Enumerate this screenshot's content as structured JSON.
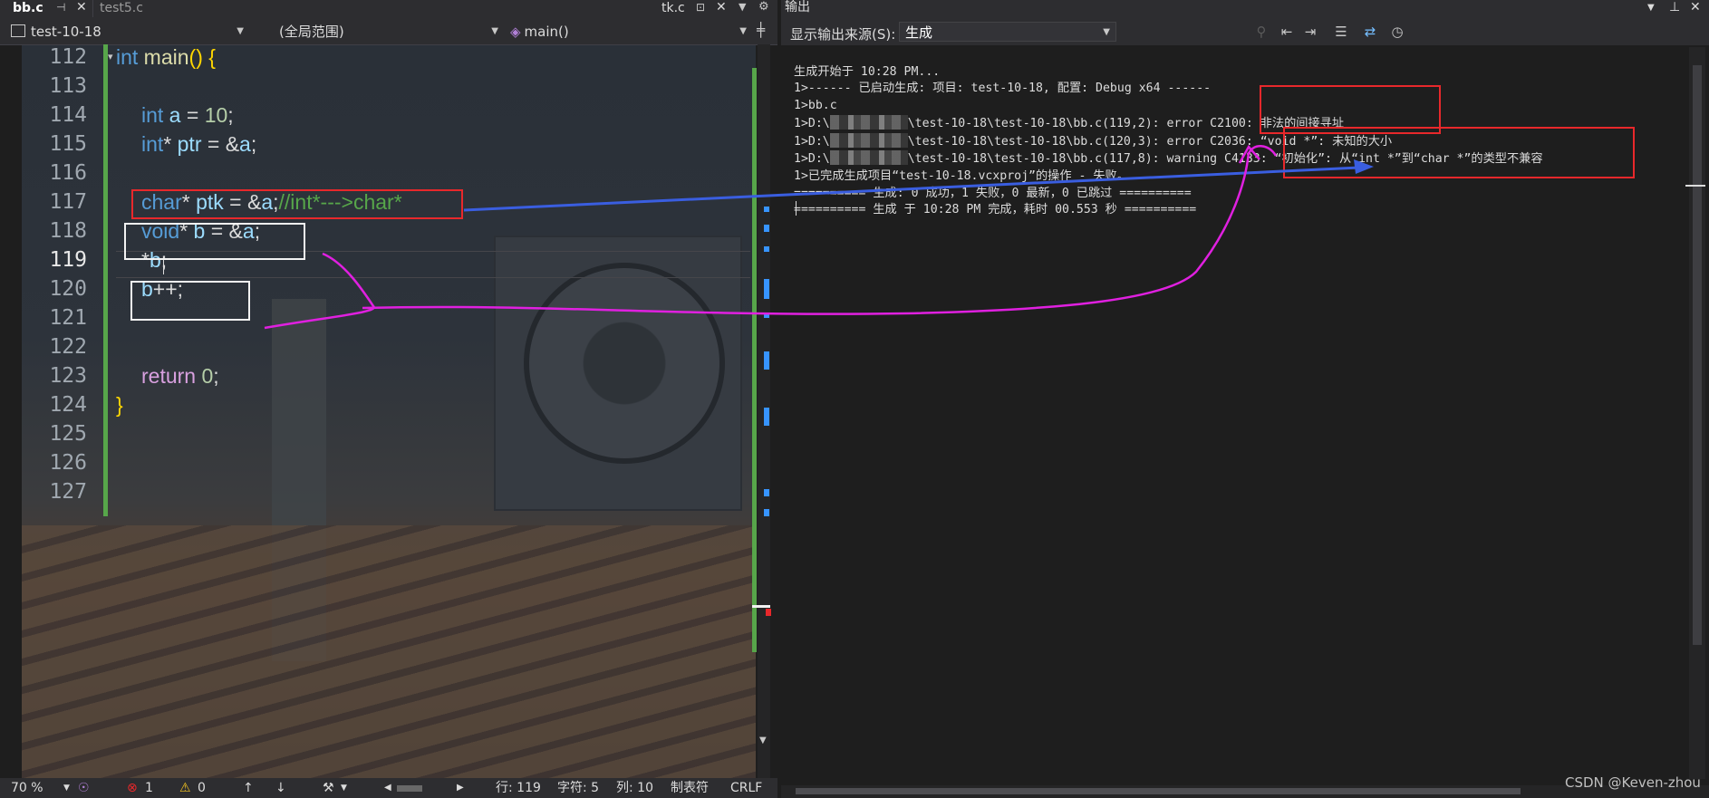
{
  "editor": {
    "tabs": [
      {
        "label": "bb.c",
        "active": true
      },
      {
        "label": "test5.c",
        "active": false
      }
    ],
    "right_tab": "tk.c",
    "nav": {
      "project": "test-10-18",
      "scope": "(全局范围)",
      "member": "main()"
    },
    "line_numbers": [
      "112",
      "113",
      "114",
      "115",
      "116",
      "117",
      "118",
      "119",
      "120",
      "121",
      "122",
      "123",
      "124",
      "125",
      "126",
      "127"
    ],
    "current_line": "119",
    "code": {
      "l112_kw": "int",
      "l112_fn": " main",
      "l112_paren": "() ",
      "l112_brace": "{",
      "l114_kw": "int",
      "l114_var": " a",
      "l114_rest": " = ",
      "l114_num": "10",
      "l114_end": ";",
      "l115_kw": "int",
      "l115_rest": "* ",
      "l115_var": "ptr",
      "l115_rest2": " = &",
      "l115_var2": "a",
      "l115_end": ";",
      "l117_kw": "char",
      "l117_rest": "* ",
      "l117_var": "ptk",
      "l117_rest2": " = &",
      "l117_var2": "a",
      "l117_end": ";",
      "l117_cmt": "//int*--->char*",
      "l118_kw": "void",
      "l118_rest": "* ",
      "l118_var": "b",
      "l118_rest2": " = &",
      "l118_var2": "a",
      "l118_end": ";",
      "l119_rest": "*",
      "l119_var": "b",
      "l119_end": ";",
      "l120_var": "b",
      "l120_rest": "++;",
      "l123_kw": "return",
      "l123_num": " 0",
      "l123_end": ";",
      "l124_brace": "}"
    },
    "status": {
      "zoom": "70 %",
      "errors": "1",
      "warnings": "0",
      "line": "行: 119",
      "char": "字符: 5",
      "col": "列: 10",
      "tabs_mode": "制表符",
      "eol": "CRLF"
    }
  },
  "output": {
    "title": "输出",
    "source_label": "显示输出来源(S):",
    "source_value": "生成",
    "lines": [
      "生成开始于 10:28 PM...",
      "1>------ 已启动生成: 项目: test-10-18, 配置: Debug x64 ------",
      "1>bb.c",
      "1>D:\\",
      "\\test-10-18\\test-10-18\\bb.c(119,2): error C2100: 非法的间接寻址",
      "1>D:\\",
      "\\test-10-18\\test-10-18\\bb.c(120,3): error C2036: “void *”: 未知的大小",
      "1>D:\\",
      "\\test-10-18\\test-10-18\\bb.c(117,8): warning C4133: “初始化”: 从“int *”到“char *”的类型不兼容",
      "1>已完成生成项目“test-10-18.vcxproj”的操作 - 失败。",
      "========== 生成: 0 成功，1 失败，0 最新，0 已跳过 ==========",
      "========== 生成 于 10:28 PM 完成，耗时 00.553 秒 =========="
    ]
  },
  "watermark": "CSDN @Keven-zhou",
  "colors": {
    "annotation_red": "#e8282b",
    "annotation_blue": "#3a5ee0",
    "annotation_magenta": "#e020e0",
    "change_bar_green": "#57a64a"
  }
}
